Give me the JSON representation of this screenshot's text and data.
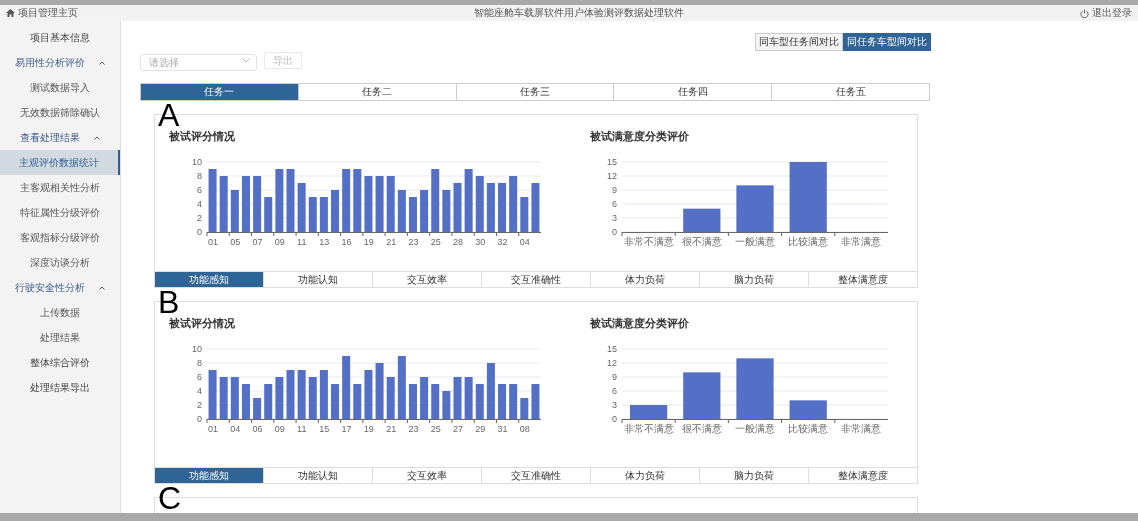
{
  "header": {
    "home_label": "项目管理主页",
    "title": "智能座舱车载屏软件用户体验测评数据处理软件",
    "logout_label": "退出登录"
  },
  "sidebar": {
    "items": [
      {
        "label": "项目基本信息",
        "selected": false
      },
      {
        "label": "易用性分析评价",
        "selected": false,
        "expanded": true,
        "children": [
          {
            "label": "测试数据导入",
            "selected": false
          },
          {
            "label": "无效数据筛除确认",
            "selected": false
          }
        ]
      },
      {
        "label": "查看处理结果",
        "selected": false,
        "expanded": true,
        "children": [
          {
            "label": "主观评价数据统计",
            "selected": true
          },
          {
            "label": "主客观相关性分析",
            "selected": false
          },
          {
            "label": "特征属性分级评价",
            "selected": false
          },
          {
            "label": "客观指标分级评价",
            "selected": false
          },
          {
            "label": "深度访谈分析",
            "selected": false
          }
        ]
      },
      {
        "label": "行驶安全性分析",
        "selected": false,
        "expanded": true,
        "children": [
          {
            "label": "上传数据",
            "selected": false
          },
          {
            "label": "处理结果",
            "selected": false
          }
        ]
      },
      {
        "label": "整体综合评价",
        "selected": false
      },
      {
        "label": "处理结果导出",
        "selected": false
      }
    ]
  },
  "compare_toggle": [
    {
      "label": "同车型任务间对比",
      "selected": false
    },
    {
      "label": "同任务车型间对比",
      "selected": true
    }
  ],
  "filter": {
    "placeholder": "请选择"
  },
  "export_button": "导出",
  "task_tabs": [
    {
      "label": "任务一",
      "selected": true
    },
    {
      "label": "任务二",
      "selected": false
    },
    {
      "label": "任务三",
      "selected": false
    },
    {
      "label": "任务四",
      "selected": false
    },
    {
      "label": "任务五",
      "selected": false
    }
  ],
  "panels": [
    {
      "marker": "A",
      "score_chart": {
        "chart_data": {
          "type": "bar",
          "title": "被试评分情况",
          "color": "#5470c6",
          "categories": [
            "01",
            null,
            "05",
            null,
            "07",
            null,
            "09",
            null,
            "11",
            null,
            "13",
            null,
            "16",
            null,
            "19",
            null,
            "21",
            null,
            "23",
            null,
            "25",
            null,
            "28",
            null,
            "30",
            null,
            "32",
            null,
            "04",
            null
          ],
          "values": [
            9,
            8,
            6,
            8,
            8,
            5,
            9,
            9,
            7,
            5,
            5,
            6,
            9,
            9,
            8,
            8,
            8,
            6,
            5,
            6,
            9,
            6,
            7,
            9,
            8,
            7,
            7,
            8,
            5,
            7
          ],
          "ylim": [
            0,
            10
          ],
          "yticks": [
            0,
            2,
            4,
            6,
            8,
            10
          ],
          "grid": true
        }
      },
      "satisfaction_chart": {
        "chart_data": {
          "type": "bar",
          "title": "被试满意度分类评价",
          "color": "#5470c6",
          "categories": [
            "非常不满意",
            "很不满意",
            "一般满意",
            "比较满意",
            "非常满意"
          ],
          "values": [
            0,
            5,
            10,
            15,
            0
          ],
          "ylim": [
            0,
            15
          ],
          "yticks": [
            0,
            3,
            6,
            9,
            12,
            15
          ],
          "grid": true
        }
      },
      "dimension_tabs": [
        {
          "label": "功能感知",
          "selected": true
        },
        {
          "label": "功能认知",
          "selected": false
        },
        {
          "label": "交互效率",
          "selected": false
        },
        {
          "label": "交互准确性",
          "selected": false
        },
        {
          "label": "体力负荷",
          "selected": false
        },
        {
          "label": "脑力负荷",
          "selected": false
        },
        {
          "label": "整体满意度",
          "selected": false
        }
      ]
    },
    {
      "marker": "B",
      "score_chart": {
        "chart_data": {
          "type": "bar",
          "title": "被试评分情况",
          "color": "#5470c6",
          "categories": [
            "01",
            null,
            "04",
            null,
            "06",
            null,
            "09",
            null,
            "11",
            null,
            "15",
            null,
            "17",
            null,
            "19",
            null,
            "21",
            null,
            "23",
            null,
            "25",
            null,
            "27",
            null,
            "29",
            null,
            "31",
            null,
            "08",
            null
          ],
          "values": [
            7,
            6,
            6,
            5,
            3,
            5,
            6,
            7,
            7,
            6,
            7,
            5,
            9,
            5,
            7,
            8,
            6,
            9,
            5,
            6,
            5,
            4,
            6,
            6,
            5,
            8,
            5,
            5,
            3,
            5
          ],
          "ylim": [
            0,
            10
          ],
          "yticks": [
            0,
            2,
            4,
            6,
            8,
            10
          ],
          "grid": true
        }
      },
      "satisfaction_chart": {
        "chart_data": {
          "type": "bar",
          "title": "被试满意度分类评价",
          "color": "#5470c6",
          "categories": [
            "非常不满意",
            "很不满意",
            "一般满意",
            "比较满意",
            "非常满意"
          ],
          "values": [
            3,
            10,
            13,
            4,
            0
          ],
          "ylim": [
            0,
            15
          ],
          "yticks": [
            0,
            3,
            6,
            9,
            12,
            15
          ],
          "grid": true
        }
      },
      "dimension_tabs": [
        {
          "label": "功能感知",
          "selected": true
        },
        {
          "label": "功能认知",
          "selected": false
        },
        {
          "label": "交互效率",
          "selected": false
        },
        {
          "label": "交互准确性",
          "selected": false
        },
        {
          "label": "体力负荷",
          "selected": false
        },
        {
          "label": "脑力负荷",
          "selected": false
        },
        {
          "label": "整体满意度",
          "selected": false
        }
      ]
    },
    {
      "marker": "C"
    }
  ]
}
